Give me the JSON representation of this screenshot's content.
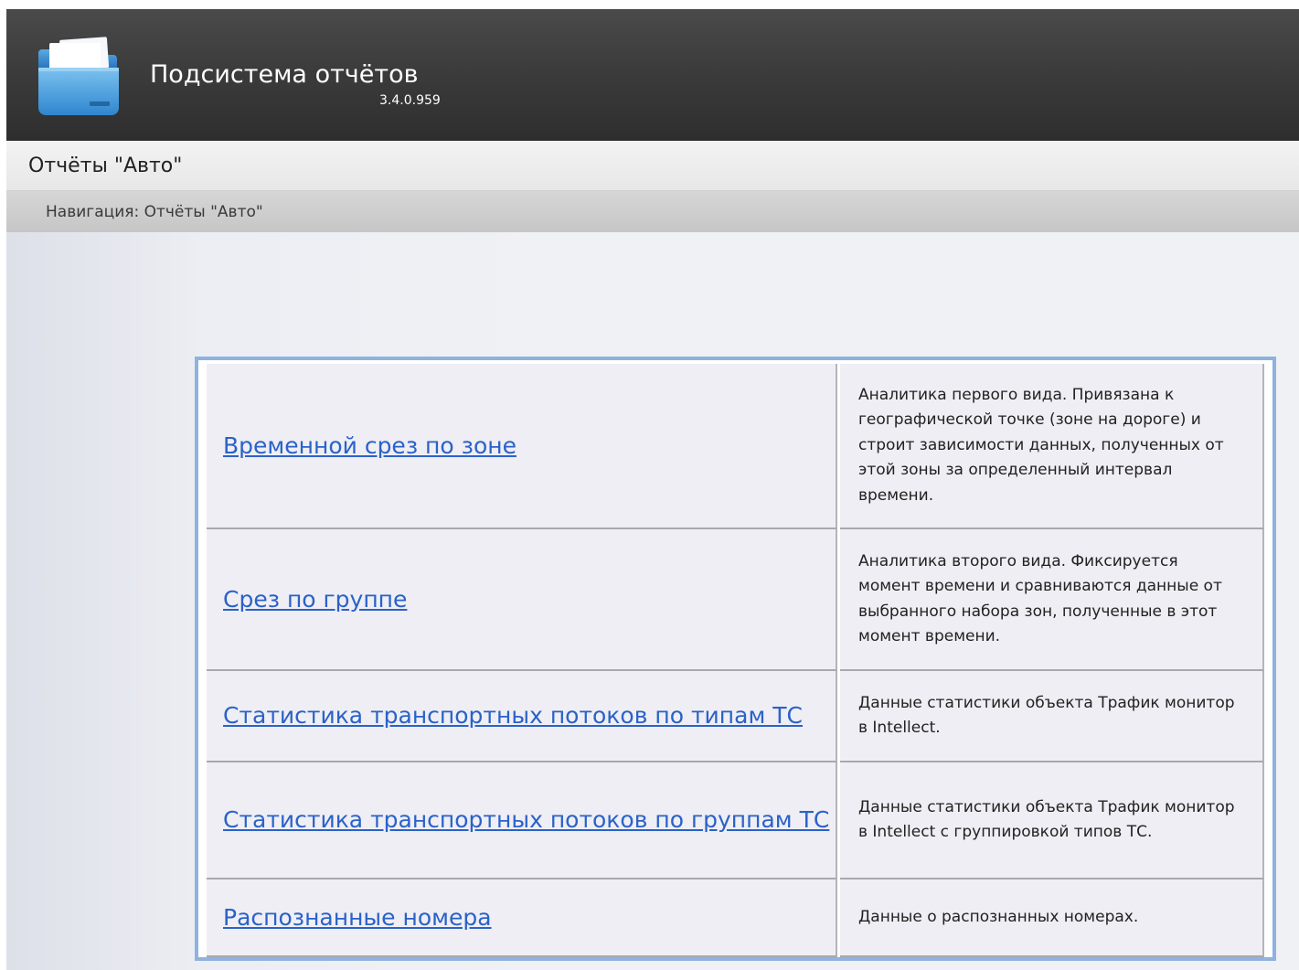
{
  "header": {
    "app_title": "Подсистема отчётов",
    "version": "3.4.0.959",
    "logo_icon": "folder-icon",
    "colors": {
      "background": "#3c3c3c",
      "logo_blue": "#3a97dc"
    }
  },
  "page": {
    "title": "Отчёты \"Авто\""
  },
  "navigation": {
    "breadcrumb": "Навигация: Отчёты \"Авто\""
  },
  "reports": [
    {
      "link": "Временной срез по зоне",
      "description": "Аналитика первого вида. Привязана к географической точке (зоне на дороге) и строит зависимости данных, полученных от этой зоны за определенный интервал времени."
    },
    {
      "link": "Срез по группе",
      "description": "Аналитика второго вида. Фиксируется момент времени и сравниваются данные от выбранного набора зон, полученные в этот момент времени."
    },
    {
      "link": "Статистика транспортных потоков по типам ТС",
      "description": "Данные статистики объекта Трафик монитор в Intellect."
    },
    {
      "link": "Статистика транспортных потоков по группам ТС",
      "description": "Данные статистики объекта Трафик монитор в Intellect с группировкой типов ТС."
    },
    {
      "link": "Распознанные номера",
      "description": "Данные о распознанных номерах."
    }
  ],
  "colors": {
    "link": "#2a62c8",
    "table_border": "#8fb2de",
    "cell_background": "#eeeef4"
  }
}
